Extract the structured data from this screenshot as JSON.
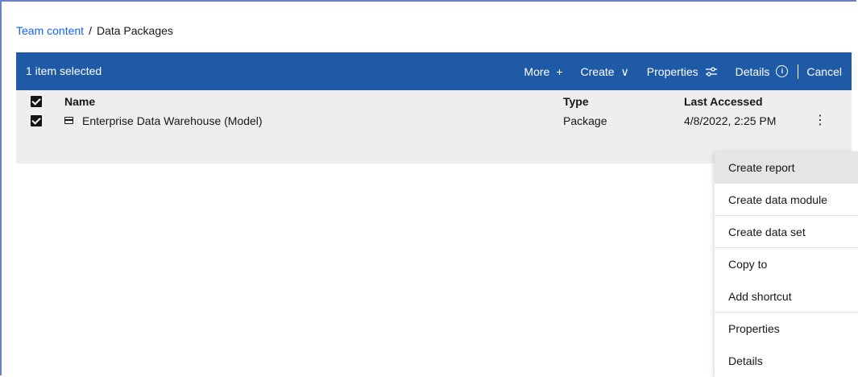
{
  "breadcrumb": {
    "root": "Team content",
    "separator": "/",
    "current": "Data Packages"
  },
  "toolbar": {
    "selection": "1 item selected",
    "more_label": "More",
    "more_icon": "+",
    "create_label": "Create",
    "create_icon": "∨",
    "properties_label": "Properties",
    "details_label": "Details",
    "details_icon": "i",
    "cancel_label": "Cancel",
    "background": "#1f5aa6"
  },
  "table": {
    "columns": {
      "name": "Name",
      "type": "Type",
      "last_accessed": "Last Accessed"
    },
    "rows": [
      {
        "name": "Enterprise Data Warehouse (Model)",
        "type": "Package",
        "last_accessed": "4/8/2022, 2:25 PM",
        "selected": true
      }
    ],
    "overflow_icon": "⋮"
  },
  "menu": {
    "items": [
      "Create report",
      "Create data module",
      "Create data set",
      "Copy to",
      "Add shortcut",
      "Properties",
      "Details"
    ]
  }
}
